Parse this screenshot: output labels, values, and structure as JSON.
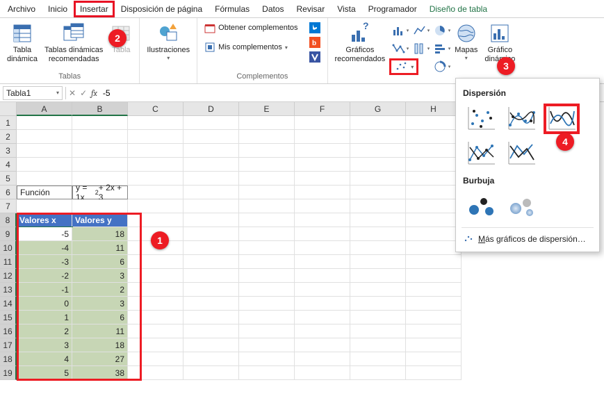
{
  "menu": {
    "items": [
      "Archivo",
      "Inicio",
      "Insertar",
      "Disposición de página",
      "Fórmulas",
      "Datos",
      "Revisar",
      "Vista",
      "Programador",
      "Diseño de tabla"
    ],
    "active_index": 2
  },
  "ribbon": {
    "tables": {
      "pivot": "Tabla\ndinámica",
      "recommended": "Tablas dinámicas\nrecomendadas",
      "table": "Tabla",
      "group": "Tablas"
    },
    "illus": {
      "btn": "Ilustraciones"
    },
    "addins": {
      "get": "Obtener complementos",
      "my": "Mis complementos",
      "group": "Complementos"
    },
    "charts": {
      "recommended": "Gráficos\nrecomendados",
      "maps": "Mapas",
      "pivotchart": "Gráfico\ndinámico"
    }
  },
  "namebox": {
    "value": "Tabla1"
  },
  "formula": {
    "value": "-5"
  },
  "cols": [
    "A",
    "B",
    "C",
    "D",
    "E",
    "F",
    "G",
    "H"
  ],
  "rows": [
    1,
    2,
    3,
    4,
    5,
    6,
    7,
    8,
    9,
    10,
    11,
    12,
    13,
    14,
    15,
    16,
    17,
    18,
    19
  ],
  "sheet": {
    "a6": "Función",
    "b6": "y = 1x",
    "b6_sup": "2",
    "b6_tail": " + 2x + 3",
    "thead_x": "Valores x",
    "thead_y": "Valores y",
    "data": [
      {
        "x": -5,
        "y": 18
      },
      {
        "x": -4,
        "y": 11
      },
      {
        "x": -3,
        "y": 6
      },
      {
        "x": -2,
        "y": 3
      },
      {
        "x": -1,
        "y": 2
      },
      {
        "x": 0,
        "y": 3
      },
      {
        "x": 1,
        "y": 6
      },
      {
        "x": 2,
        "y": 11
      },
      {
        "x": 3,
        "y": 18
      },
      {
        "x": 4,
        "y": 27
      },
      {
        "x": 5,
        "y": 38
      }
    ]
  },
  "dropdown": {
    "scatter_title": "Dispersión",
    "bubble_title": "Burbuja",
    "more": "Más gráficos de dispersión…",
    "more_u": "M"
  },
  "callouts": {
    "c1": "1",
    "c2": "2",
    "c3": "3",
    "c4": "4"
  },
  "chart_data": {
    "type": "scatter",
    "title": "y = 1x^2 + 2x + 3",
    "xlabel": "Valores x",
    "ylabel": "Valores y",
    "x": [
      -5,
      -4,
      -3,
      -2,
      -1,
      0,
      1,
      2,
      3,
      4,
      5
    ],
    "y": [
      18,
      11,
      6,
      3,
      2,
      3,
      6,
      11,
      18,
      27,
      38
    ]
  }
}
